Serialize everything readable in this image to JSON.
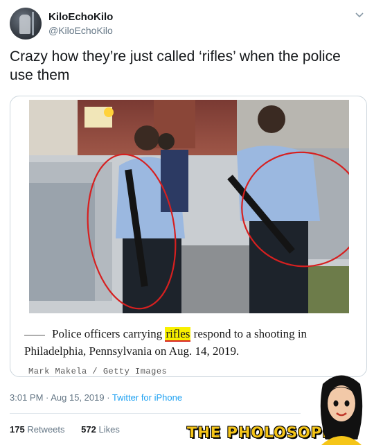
{
  "tweet": {
    "display_name": "KiloEchoKilo",
    "handle": "@KiloEchoKilo",
    "text": "Crazy how they’re just called ‘rifles’ when the police use them",
    "timestamp": "3:01 PM · Aug 15, 2019 · ",
    "source": "Twitter for iPhone",
    "retweets_count": "175",
    "retweets_label": "Retweets",
    "likes_count": "572",
    "likes_label": "Likes"
  },
  "card": {
    "caption_before": "Police officers carrying ",
    "caption_highlight": "rifles",
    "caption_after": " respond to a shooting in Philadelphia, Pennsylvania on Aug. 14, 2019.",
    "credit": "Mark Makela / Getty Images"
  },
  "watermark": {
    "text": "THE PHOLOSOPHER"
  },
  "colors": {
    "highlight": "#f8f000",
    "annotation_circle": "#d62020",
    "link": "#1da1f2",
    "watermark": "#f5c518"
  }
}
